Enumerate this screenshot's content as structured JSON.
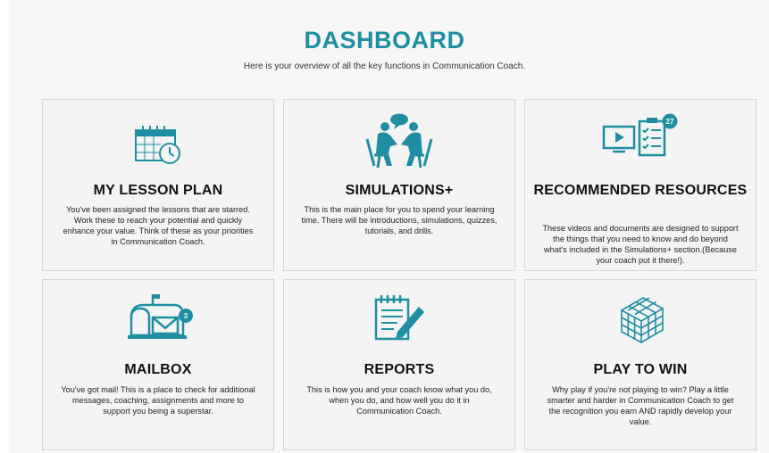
{
  "header": {
    "title": "DASHBOARD",
    "subtitle": "Here is your overview of all the key functions in Communication Coach."
  },
  "colors": {
    "accent": "#1f8ea3",
    "card_bg": "#f4f4f4",
    "card_border": "#d6d6d6"
  },
  "cards": [
    {
      "title": "MY LESSON PLAN",
      "icon": "calendar-clock-icon",
      "text": "You've been assigned the lessons that are starred. Work these to reach your potential and quickly enhance your value. Think of these as your priorities in Communication Coach."
    },
    {
      "title": "SIMULATIONS+",
      "icon": "conversation-icon",
      "text": "This is the main place for you to spend your learning time. There will be introductions, simulations, quizzes, tutorials, and drills."
    },
    {
      "title": "RECOMMENDED RESOURCES",
      "icon": "video-checklist-icon",
      "badge": "27",
      "text": "These videos and documents are designed to support the things that you need to know and do beyond what's included in the Simulations+ section.(Because your coach put it there!)."
    },
    {
      "title": "MAILBOX",
      "icon": "mailbox-icon",
      "badge": "3",
      "text": "You've got mail! This is a place to check for additional messages, coaching, assignments and more to support you being a superstar."
    },
    {
      "title": "REPORTS",
      "icon": "report-pencil-icon",
      "text": "This is how you and your coach know what you do, when you do, and how well you do it in Communication Coach."
    },
    {
      "title": "PLAY TO WIN",
      "icon": "rubiks-cube-icon",
      "text": "Why play if you're not playing to win? Play a little smarter and harder in Communication Coach to get the recognition you earn AND rapidly develop your value."
    }
  ]
}
